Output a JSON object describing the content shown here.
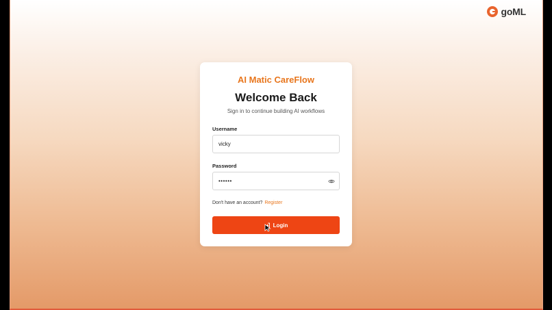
{
  "brand": {
    "name": "goML",
    "icon": "goml-logo-icon"
  },
  "login": {
    "app_title": "AI Matic CareFlow",
    "heading": "Welcome Back",
    "subtitle": "Sign in to continue building AI workflows",
    "username": {
      "label": "Username",
      "value": "vicky"
    },
    "password": {
      "label": "Password",
      "value": "••••••",
      "toggle_icon": "eye-icon"
    },
    "register_prompt": "Don't have an account?",
    "register_link": "Register",
    "login_button": "Login",
    "login_icon": "login-arrow-icon"
  },
  "colors": {
    "accent": "#e8761d",
    "button": "#ee4514"
  }
}
